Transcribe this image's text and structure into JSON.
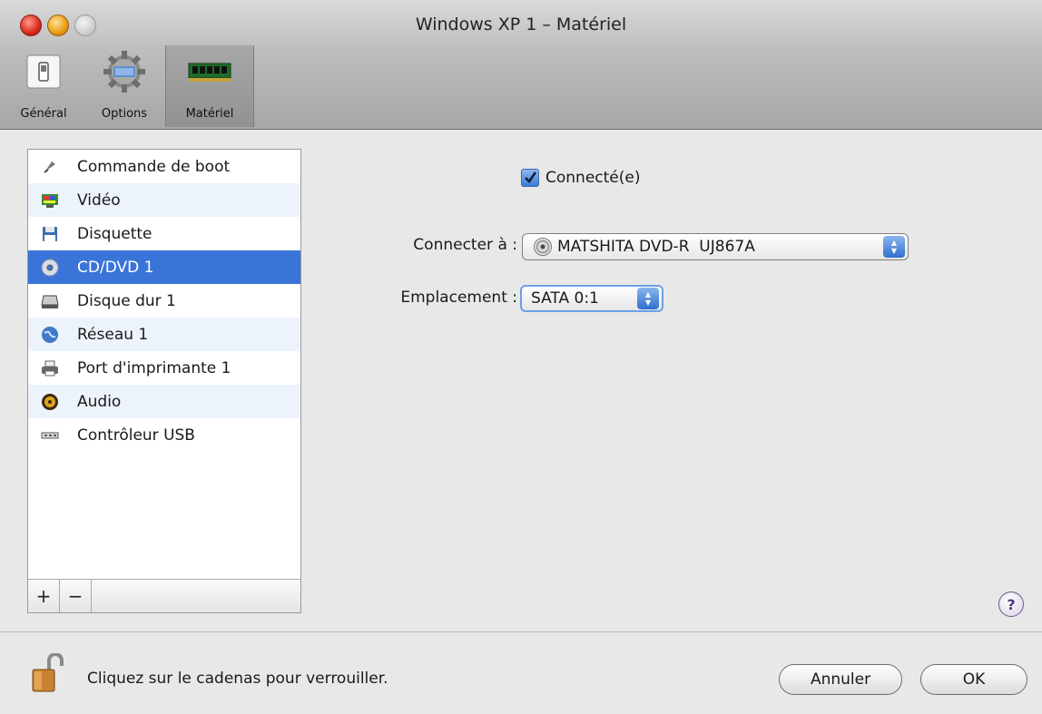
{
  "window": {
    "title": "Windows XP 1 – Matériel"
  },
  "toolbar": {
    "general_label": "Général",
    "options_label": "Options",
    "materiel_label": "Matériel",
    "selected": "Matériel"
  },
  "sidebar": {
    "items": [
      {
        "label": "Commande de boot",
        "icon": "boot-order-icon"
      },
      {
        "label": "Vidéo",
        "icon": "video-icon"
      },
      {
        "label": "Disquette",
        "icon": "floppy-icon"
      },
      {
        "label": "CD/DVD 1",
        "icon": "cd-dvd-icon",
        "selected": true
      },
      {
        "label": "Disque dur 1",
        "icon": "hard-disk-icon"
      },
      {
        "label": "Réseau 1",
        "icon": "network-icon"
      },
      {
        "label": "Port d'imprimante 1",
        "icon": "printer-icon"
      },
      {
        "label": "Audio",
        "icon": "audio-icon"
      },
      {
        "label": "Contrôleur USB",
        "icon": "usb-icon"
      }
    ],
    "add_label": "+",
    "remove_label": "−"
  },
  "form": {
    "connected_label": "Connecté(e)",
    "connected_checked": true,
    "connect_to_label": "Connecter à :",
    "connect_to_value": "MATSHITA DVD-R  UJ867A",
    "location_label": "Emplacement :",
    "location_value": "SATA 0:1"
  },
  "footer": {
    "lock_text": "Cliquez sur le cadenas pour verrouiller.",
    "cancel_label": "Annuler",
    "ok_label": "OK",
    "help_label": "?"
  },
  "colors": {
    "selection": "#3a74d8",
    "alt_row": "#edf3fb"
  }
}
